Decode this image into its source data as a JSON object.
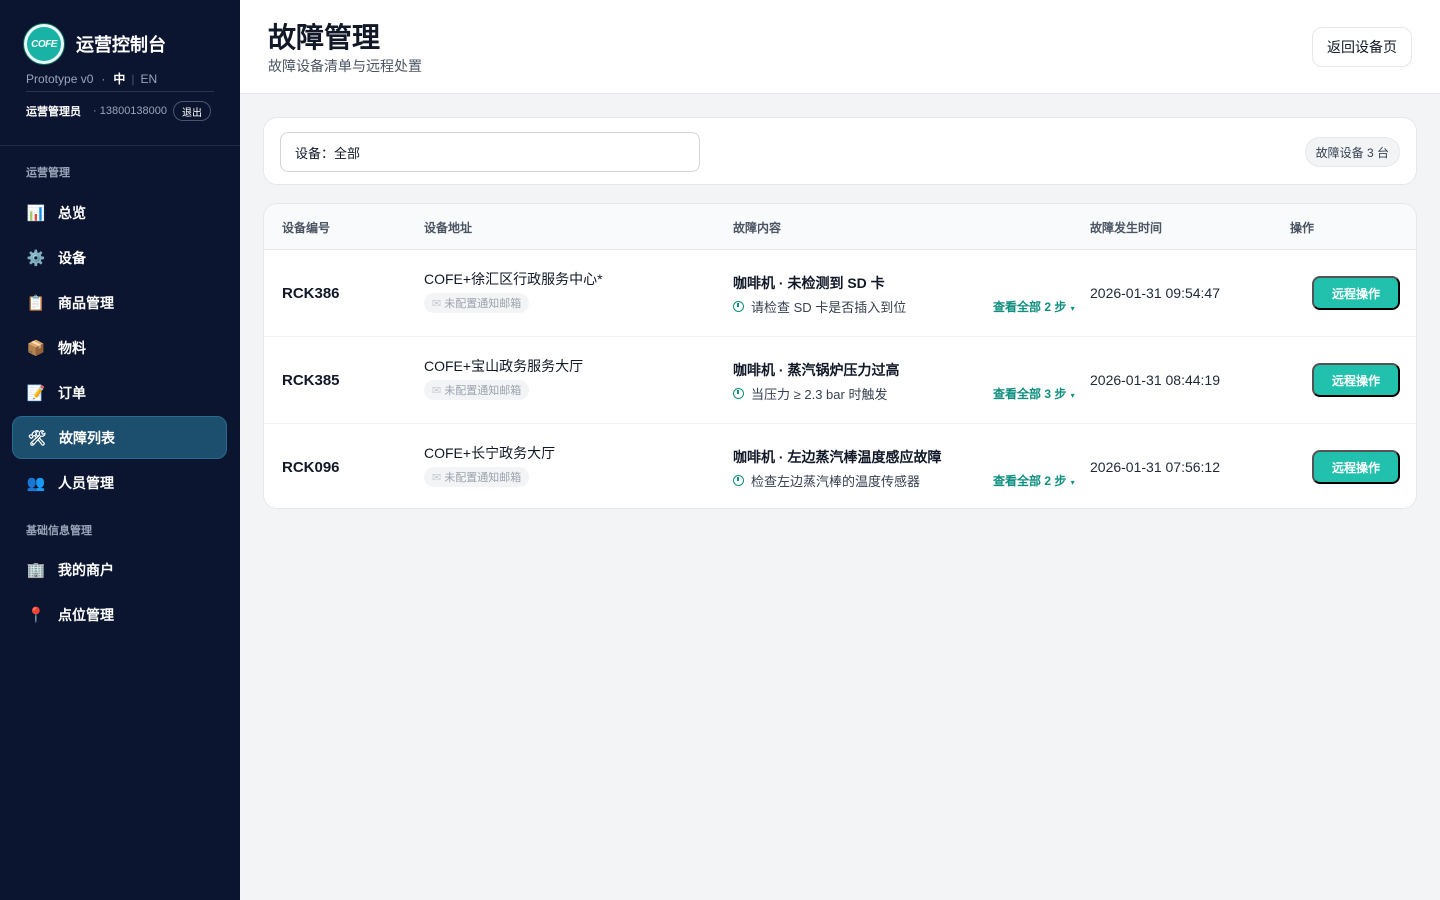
{
  "sidebar": {
    "logo_text": "COFE",
    "app_title": "运营控制台",
    "version": "Prototype v0",
    "lang_cn": "中",
    "lang_en": "EN",
    "user_role": "运营管理员",
    "user_phone": "· 13800138000",
    "logout_label": "退出",
    "section_ops": "运营管理",
    "section_basic": "基础信息管理",
    "items": [
      {
        "label": "总览",
        "icon": "📊",
        "icon_name": "chart-icon"
      },
      {
        "label": "设备",
        "icon": "⚙️",
        "icon_name": "gear-icon"
      },
      {
        "label": "商品管理",
        "icon": "📋",
        "icon_name": "clipboard-icon"
      },
      {
        "label": "物料",
        "icon": "📦",
        "icon_name": "package-icon"
      },
      {
        "label": "订单",
        "icon": "📝",
        "icon_name": "memo-icon"
      },
      {
        "label": "故障列表",
        "icon": "🛠",
        "icon_name": "tools-icon",
        "active": true
      },
      {
        "label": "人员管理",
        "icon": "👥",
        "icon_name": "people-icon"
      },
      {
        "label": "我的商户",
        "icon": "🏢",
        "icon_name": "building-icon"
      },
      {
        "label": "点位管理",
        "icon": "📍",
        "icon_name": "pin-icon"
      }
    ]
  },
  "header": {
    "title": "故障管理",
    "subtitle": "故障设备清单与远程处置",
    "back_label": "返回设备页"
  },
  "filter": {
    "device_select_value": "设备：全部",
    "count_badge": "故障设备 3 台"
  },
  "table": {
    "columns": [
      "设备编号",
      "设备地址",
      "故障内容",
      "故障发生时间",
      "操作"
    ],
    "mail_tag": "未配置通知邮箱",
    "action_label": "远程操作",
    "rows": [
      {
        "id": "RCK386",
        "address": "COFE+徐汇区行政服务中心*",
        "fault_title": "咖啡机 · 未检测到 SD 卡",
        "fault_step": "请检查 SD 卡是否插入到位",
        "view_all": "查看全部 2 步",
        "time": "2026-01-31 09:54:47"
      },
      {
        "id": "RCK385",
        "address": "COFE+宝山政务服务大厅",
        "fault_title": "咖啡机 · 蒸汽锅炉压力过高",
        "fault_step": "当压力 ≥ 2.3 bar 时触发",
        "view_all": "查看全部 3 步",
        "time": "2026-01-31 08:44:19"
      },
      {
        "id": "RCK096",
        "address": "COFE+长宁政务大厅",
        "fault_title": "咖啡机 · 左边蒸汽棒温度感应故障",
        "fault_step": "检查左边蒸汽棒的温度传感器",
        "view_all": "查看全部 2 步",
        "time": "2026-01-31 07:56:12"
      }
    ]
  },
  "colors": {
    "sidebar_bg": "#0c1530",
    "active_nav_bg": "#1c4e6e",
    "accent": "#22c1ad",
    "link": "#0f8f7f"
  }
}
